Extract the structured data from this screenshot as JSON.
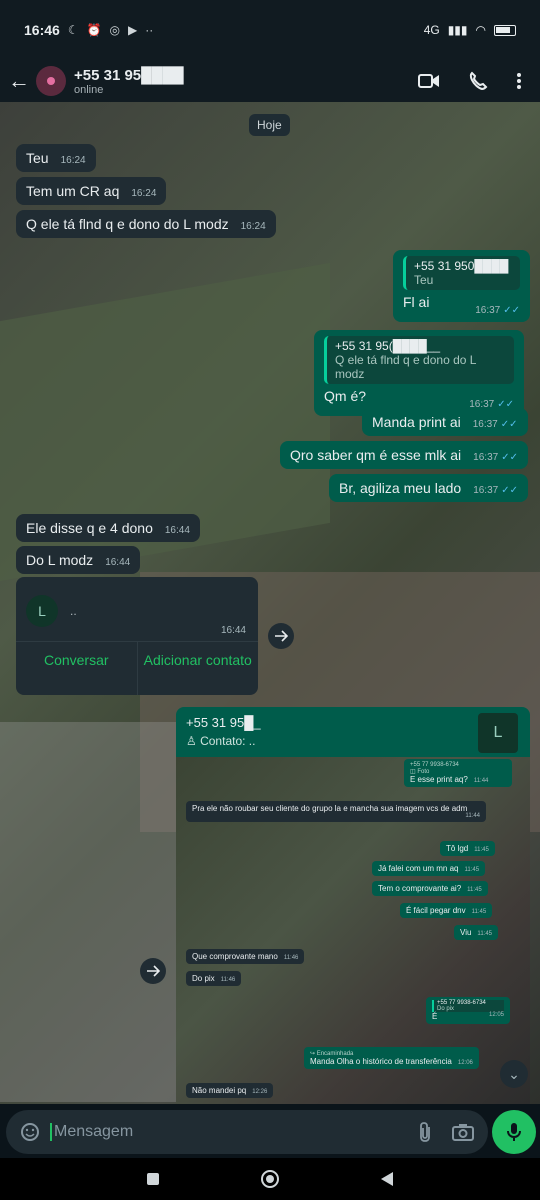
{
  "status_bar": {
    "time": "16:46",
    "network": "4G"
  },
  "header": {
    "title": "+55 31 95████",
    "status": "online"
  },
  "chat": {
    "date_chip": "Hoje",
    "messages": [
      {
        "text": "Teu",
        "time": "16:24"
      },
      {
        "text": "Tem um CR aq",
        "time": "16:24"
      },
      {
        "text": "Q ele tá flnd q e dono do L modz",
        "time": "16:24"
      },
      {
        "quote_name": "+55 31 950████",
        "quote_text": "Teu",
        "text": "Fl ai",
        "time": "16:37"
      },
      {
        "quote_name": "+55 31 95(████__",
        "quote_text": "Q ele tá flnd q e dono do L modz",
        "text": "Qm é?",
        "time": "16:37"
      },
      {
        "text": "Manda print ai",
        "time": "16:37"
      },
      {
        "text": "Qro saber qm é esse mlk ai",
        "time": "16:37"
      },
      {
        "text": "Br, agiliza meu lado",
        "time": "16:37"
      },
      {
        "text": "Ele disse q e 4 dono",
        "time": "16:44"
      },
      {
        "text": "Do L modz",
        "time": "16:44"
      }
    ],
    "contact_card": {
      "avatar": "L",
      "name": "..",
      "time": "16:44",
      "button_chat": "Conversar",
      "button_add": "Adicionar contato"
    },
    "out_contact": {
      "name": "+55 31 95█_",
      "sub": "Contato: ..",
      "avatar": "L"
    },
    "screenshot": {
      "items": [
        {
          "text": "E esse print aq?",
          "time": "11:44",
          "caption": "Foto",
          "header": "+55 77 9938-6734"
        },
        {
          "text": "Pra ele não roubar seu cliente do grupo la e mancha sua imagem vcs de adm",
          "time": "11:44"
        },
        {
          "text": "Tô lgd",
          "time": "11:45"
        },
        {
          "text": "Já falei com um mn aq",
          "time": "11:45"
        },
        {
          "text": "Tem o comprovante ai?",
          "time": "11:45"
        },
        {
          "text": "É fácil pegar dnv",
          "time": "11:45"
        },
        {
          "text": "Viu",
          "time": "11:45"
        },
        {
          "text": "Que comprovante mano",
          "time": "11:46"
        },
        {
          "text": "Do pix",
          "time": "11:46"
        },
        {
          "quote_name": "+55 77 9938-6734",
          "quote_text": "Do pix",
          "text": "É",
          "time": "12:05"
        },
        {
          "forwarded": "Encaminhada",
          "text": "Manda Olha o histórico de transferência",
          "time": "12:06"
        },
        {
          "text": "Não mandei pq",
          "time": "12:26"
        }
      ]
    }
  },
  "input": {
    "placeholder": "Mensagem"
  },
  "colors": {
    "incoming": "#202c33",
    "outgoing": "#005c4b",
    "accent": "#21c063",
    "read_tick": "#53bdeb"
  }
}
